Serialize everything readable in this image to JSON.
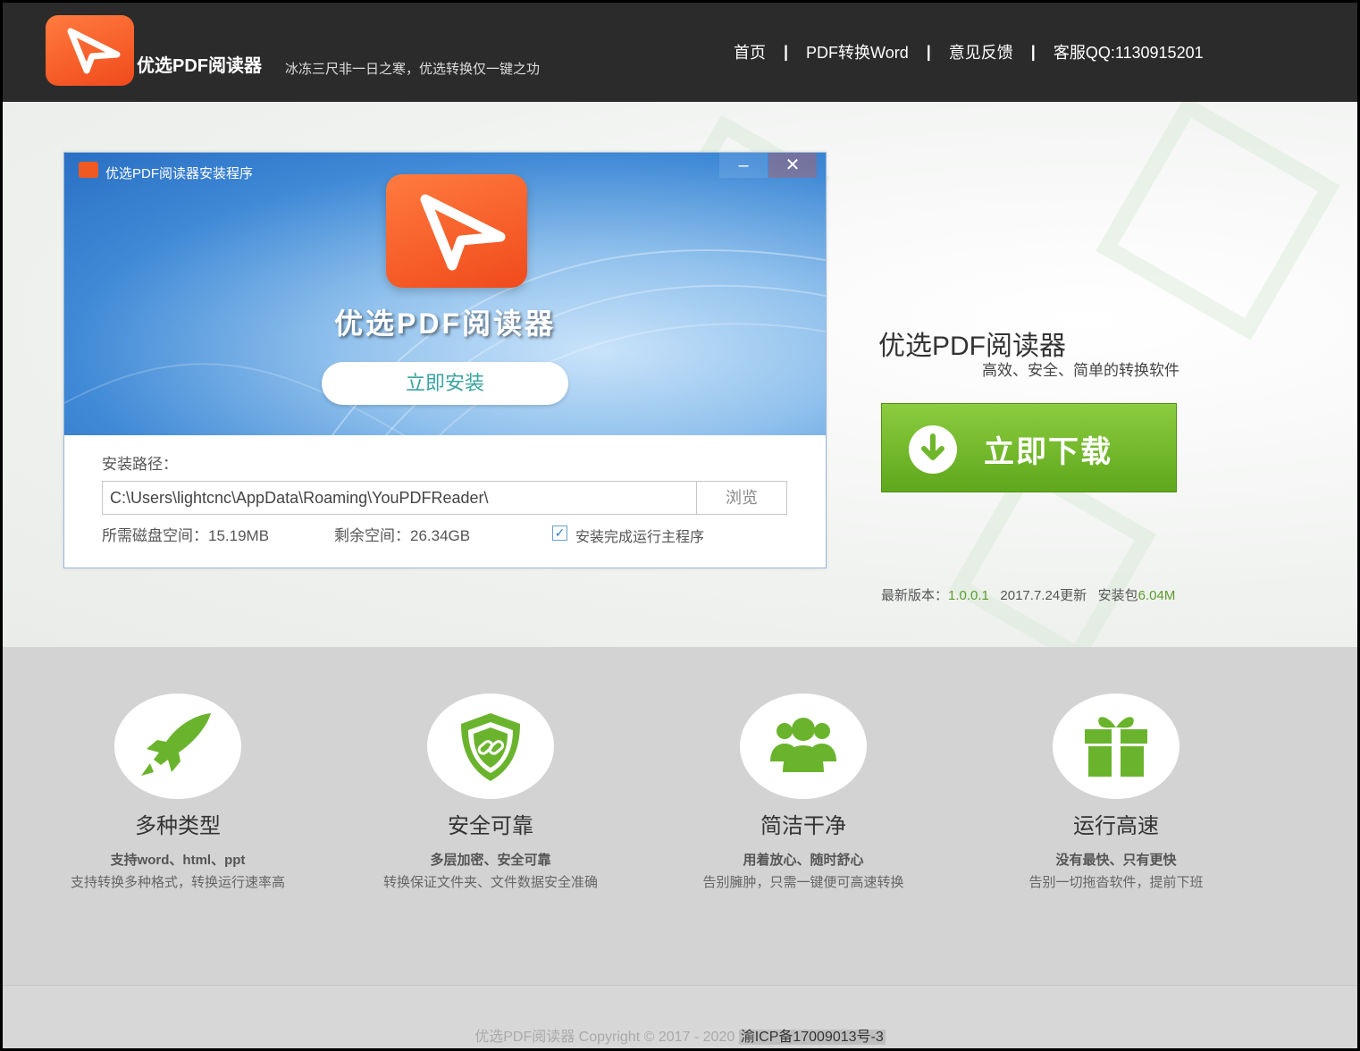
{
  "header": {
    "brand": "优选PDF阅读器",
    "slogan": "冰冻三尺非一日之寒，优选转换仅一键之功",
    "nav": [
      "首页",
      "PDF转换Word",
      "意见反馈",
      "客服QQ:1130915201"
    ],
    "nav_separator": "|"
  },
  "installer": {
    "window_title": "优选PDF阅读器安装程序",
    "minimize": "–",
    "close": "✕",
    "product_name": "优选PDF阅读器",
    "install_button": "立即安装",
    "path_label": "安装路径：",
    "path_value": "C:\\Users\\lightcnc\\AppData\\Roaming\\YouPDFReader\\",
    "browse_button": "浏览",
    "disk_required": "所需磁盘空间：15.19MB",
    "disk_free": "剩余空间：26.34GB",
    "run_after_install": "安装完成运行主程序",
    "run_after_checked": true
  },
  "product": {
    "title": "优选PDF阅读器",
    "subtitle": "高效、安全、简单的转换软件",
    "download_button": "立即下载",
    "version_label": "最新版本：",
    "version": "1.0.0.1",
    "updated": "2017.7.24更新",
    "package_label": "安装包",
    "package_size": "6.04M"
  },
  "features": [
    {
      "icon": "rocket-icon",
      "title": "多种类型",
      "sub": "支持word、html、ppt",
      "desc": "支持转换多种格式，转换运行速率高"
    },
    {
      "icon": "shield-link-icon",
      "title": "安全可靠",
      "sub": "多层加密、安全可靠",
      "desc": "转换保证文件夹、文件数据安全准确"
    },
    {
      "icon": "users-icon",
      "title": "简洁干净",
      "sub": "用着放心、随时舒心",
      "desc": "告别臃肿，只需一键便可高速转换"
    },
    {
      "icon": "gift-icon",
      "title": "运行高速",
      "sub": "没有最快、只有更快",
      "desc": "告别一切拖沓软件，提前下班"
    }
  ],
  "footer": {
    "copyright": "优选PDF阅读器 Copyright © 2017 - 2020",
    "icp": "渝ICP备17009013号-3"
  },
  "colors": {
    "header_bg": "#2b2b2b",
    "accent_orange": "#f05a22",
    "download_green": "#6fb62a",
    "feature_green": "#6ab42d"
  }
}
